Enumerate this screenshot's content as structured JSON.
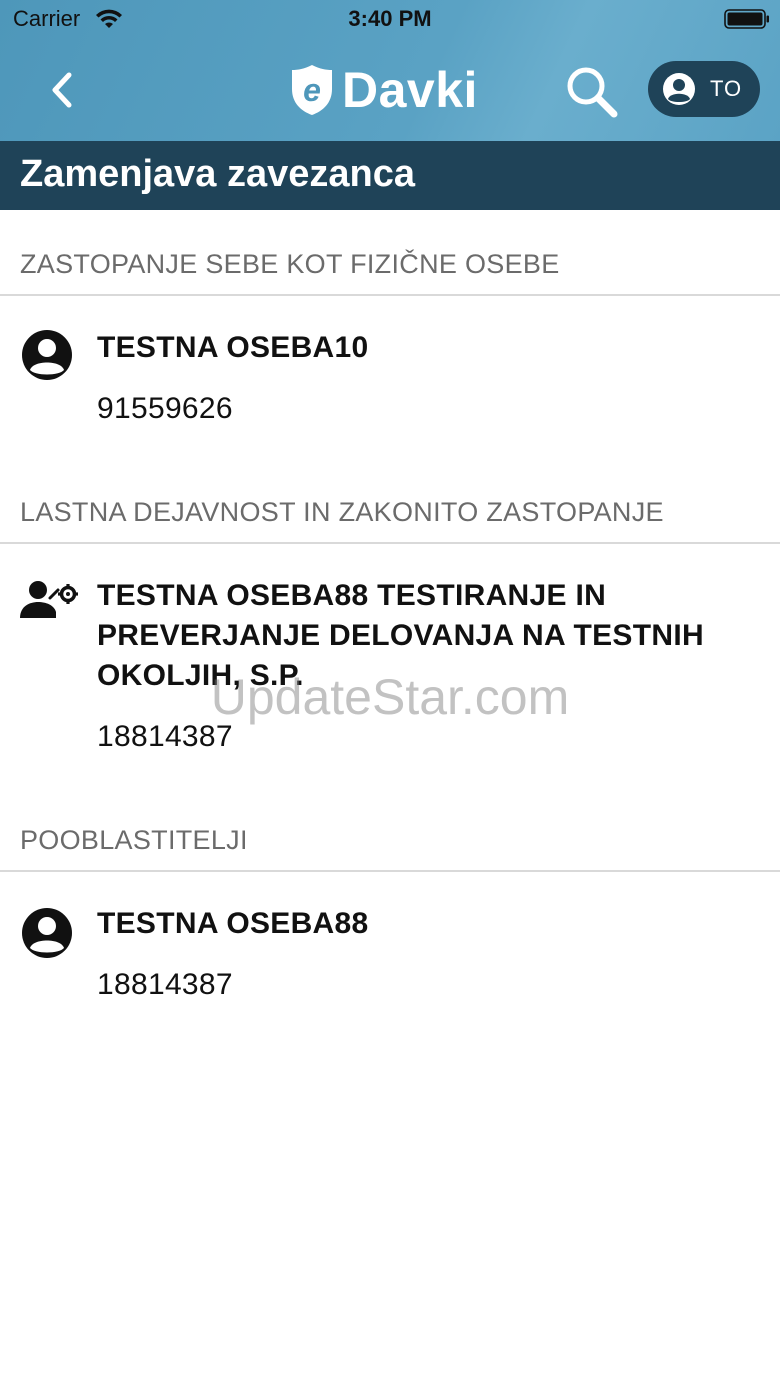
{
  "status_bar": {
    "carrier": "Carrier",
    "time": "3:40 PM"
  },
  "nav": {
    "logo_text": "Davki",
    "logo_letter": "e",
    "user_initials": "TO",
    "icons": {
      "back": "chevron-left-icon",
      "search": "search-icon",
      "user": "user-circle-icon"
    }
  },
  "page": {
    "title": "Zamenjava zavezanca"
  },
  "sections": [
    {
      "header": "ZASTOPANJE SEBE KOT FIZIČNE OSEBE",
      "items": [
        {
          "icon": "person-circle-icon",
          "name": "TESTNA OSEBA10",
          "number": "91559626"
        }
      ]
    },
    {
      "header": "LASTNA DEJAVNOST IN ZAKONITO ZASTOPANJE",
      "items": [
        {
          "icon": "person-gear-icon",
          "name": "TESTNA OSEBA88 TESTIRANJE IN PREVERJANJE DELOVANJA NA TESTNIH OKOLJIH, S.P.",
          "number": "18814387"
        }
      ]
    },
    {
      "header": "POOBLASTITELJI",
      "items": [
        {
          "icon": "person-circle-icon",
          "name": "TESTNA OSEBA88",
          "number": "18814387"
        }
      ]
    }
  ],
  "watermark": "UpdateStar.com",
  "colors": {
    "header_blue": "#5aa2c4",
    "title_bar": "#1f4358",
    "section_text": "#6b6b6b"
  }
}
